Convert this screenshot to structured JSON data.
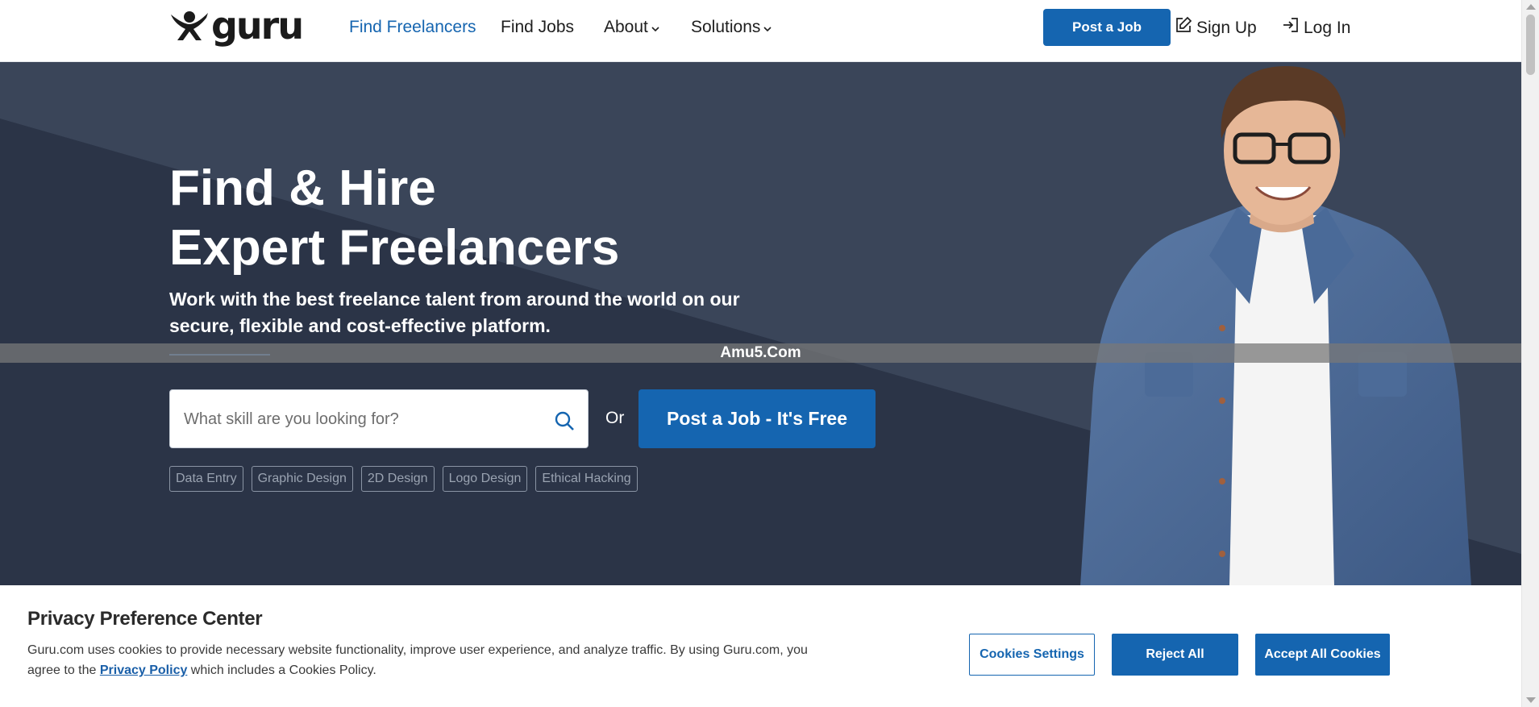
{
  "brand": {
    "name": "guru"
  },
  "nav": {
    "links": [
      {
        "label": "Find Freelancers",
        "active": true
      },
      {
        "label": "Find Jobs"
      },
      {
        "label": "About",
        "dropdown": true
      },
      {
        "label": "Solutions",
        "dropdown": true
      }
    ],
    "post_job_label": "Post a Job",
    "sign_up_label": "Sign Up",
    "log_in_label": "Log In"
  },
  "hero": {
    "title_line1": "Find & Hire",
    "title_line2": "Expert Freelancers",
    "subtitle": "Work with the best freelance talent from around the world on our secure, flexible and cost-effective platform.",
    "search_placeholder": "What skill are you looking for?",
    "or_text": "Or",
    "post_job_cta": "Post a Job - It's Free",
    "tags": [
      "Data Entry",
      "Graphic Design",
      "2D Design",
      "Logo Design",
      "Ethical Hacking"
    ]
  },
  "watermark": "Amu5.Com",
  "cookie_banner": {
    "title": "Privacy Preference Center",
    "text_before_link": "Guru.com uses cookies to provide necessary website functionality, improve user experience, and analyze traffic. By using Guru.com, you agree to the ",
    "link_text": "Privacy Policy",
    "text_after_link": " which includes a Cookies Policy.",
    "settings_label": "Cookies Settings",
    "reject_label": "Reject All",
    "accept_label": "Accept All Cookies"
  },
  "colors": {
    "brand_blue": "#1565b0",
    "hero_bg": "#3a4559",
    "hero_bg_dark": "#2b3447"
  },
  "icons": [
    "guru-logo-icon",
    "chevron-down-icon",
    "edit-icon",
    "login-icon",
    "search-icon"
  ]
}
